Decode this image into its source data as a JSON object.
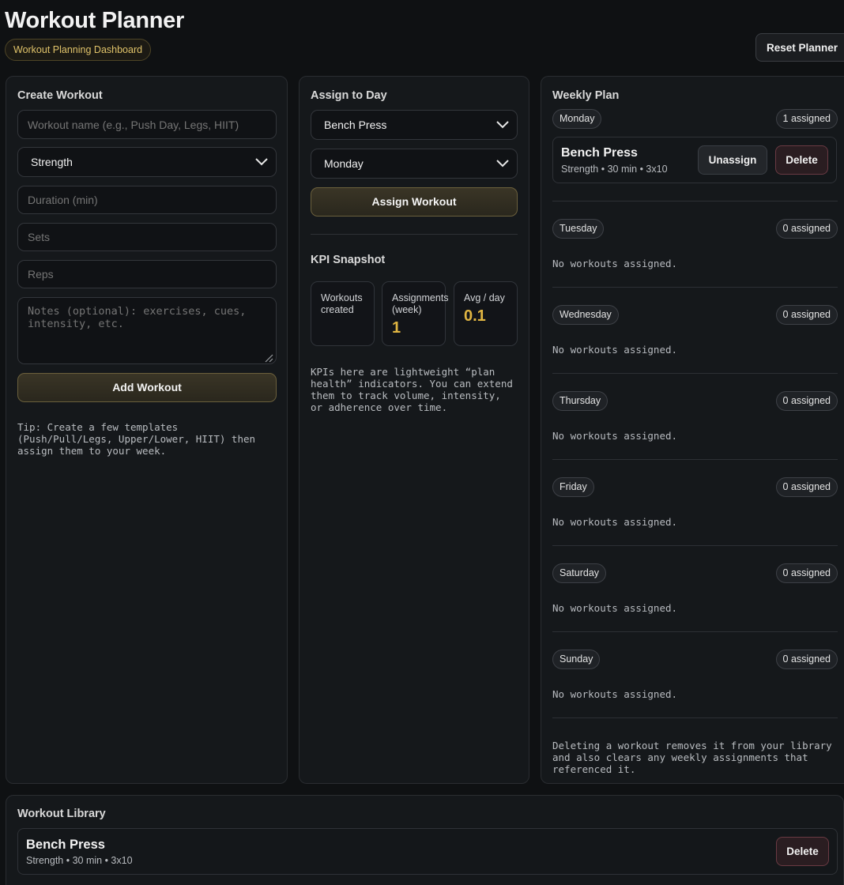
{
  "header": {
    "title": "Workout Planner",
    "badge": "Workout Planning Dashboard",
    "reset_label": "Reset Planner"
  },
  "create": {
    "title": "Create Workout",
    "name_placeholder": "Workout name (e.g., Push Day, Legs, HIIT)",
    "type_value": "Strength",
    "duration_placeholder": "Duration (min)",
    "sets_placeholder": "Sets",
    "reps_placeholder": "Reps",
    "notes_placeholder": "Notes (optional): exercises, cues, intensity, etc.",
    "add_label": "Add Workout",
    "tip": "Tip: Create a few templates (Push/Pull/Legs, Upper/Lower, HIIT) then assign them to your week."
  },
  "assign": {
    "title": "Assign to Day",
    "workout_value": "Bench Press",
    "day_value": "Monday",
    "assign_label": "Assign Workout",
    "kpi_title": "KPI Snapshot",
    "kpis": [
      {
        "label": "Workouts created",
        "value": ""
      },
      {
        "label": "Assignments (week)",
        "value": "1"
      },
      {
        "label": "Avg / day",
        "value": "0.1"
      }
    ],
    "kpi_note": "KPIs here are lightweight “plan health” indicators. You can extend them to track volume, intensity, or adherence over time."
  },
  "weekly": {
    "title": "Weekly Plan",
    "monday": {
      "day": "Monday",
      "count": "1 assigned"
    },
    "monday_item": {
      "name": "Bench Press",
      "meta": "Strength • 30 min • 3x10",
      "unassign_label": "Unassign",
      "delete_label": "Delete"
    },
    "days": [
      {
        "day": "Tuesday",
        "count": "0 assigned",
        "empty": "No workouts assigned."
      },
      {
        "day": "Wednesday",
        "count": "0 assigned",
        "empty": "No workouts assigned."
      },
      {
        "day": "Thursday",
        "count": "0 assigned",
        "empty": "No workouts assigned."
      },
      {
        "day": "Friday",
        "count": "0 assigned",
        "empty": "No workouts assigned."
      },
      {
        "day": "Saturday",
        "count": "0 assigned",
        "empty": "No workouts assigned."
      },
      {
        "day": "Sunday",
        "count": "0 assigned",
        "empty": "No workouts assigned."
      }
    ],
    "footnote": "Deleting a workout removes it from your library and also clears any weekly assignments that referenced it."
  },
  "library": {
    "title": "Workout Library",
    "items": [
      {
        "name": "Bench Press",
        "meta": "Strength • 30 min • 3x10",
        "delete_label": "Delete"
      }
    ]
  }
}
